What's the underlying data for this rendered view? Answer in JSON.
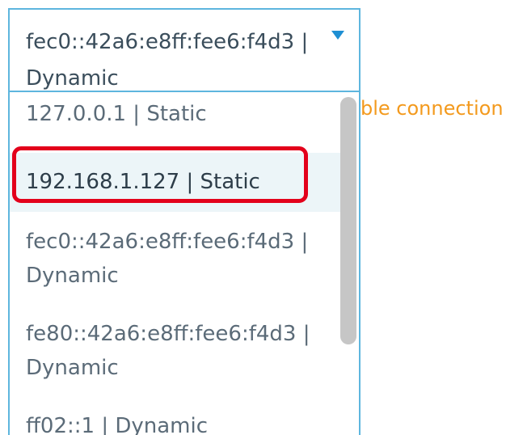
{
  "background_hint": "ble connection",
  "select": {
    "value": "fec0::42a6:e8ff:fee6:f4d3 | Dynamic"
  },
  "options": [
    {
      "label": "127.0.0.1 | Static"
    },
    {
      "label": "192.168.1.127 | Static"
    },
    {
      "label": "fec0::42a6:e8ff:fee6:f4d3 | Dynamic"
    },
    {
      "label": "fe80::42a6:e8ff:fee6:f4d3 | Dynamic"
    },
    {
      "label": "ff02::1 | Dynamic"
    }
  ],
  "colors": {
    "border": "#5eb6de",
    "caret": "#1e8fd3",
    "hint": "#f39a1e",
    "hover_bg": "#ecf5f8",
    "highlight": "#e3001b"
  },
  "icons": {
    "caret": "caret-down-icon"
  }
}
